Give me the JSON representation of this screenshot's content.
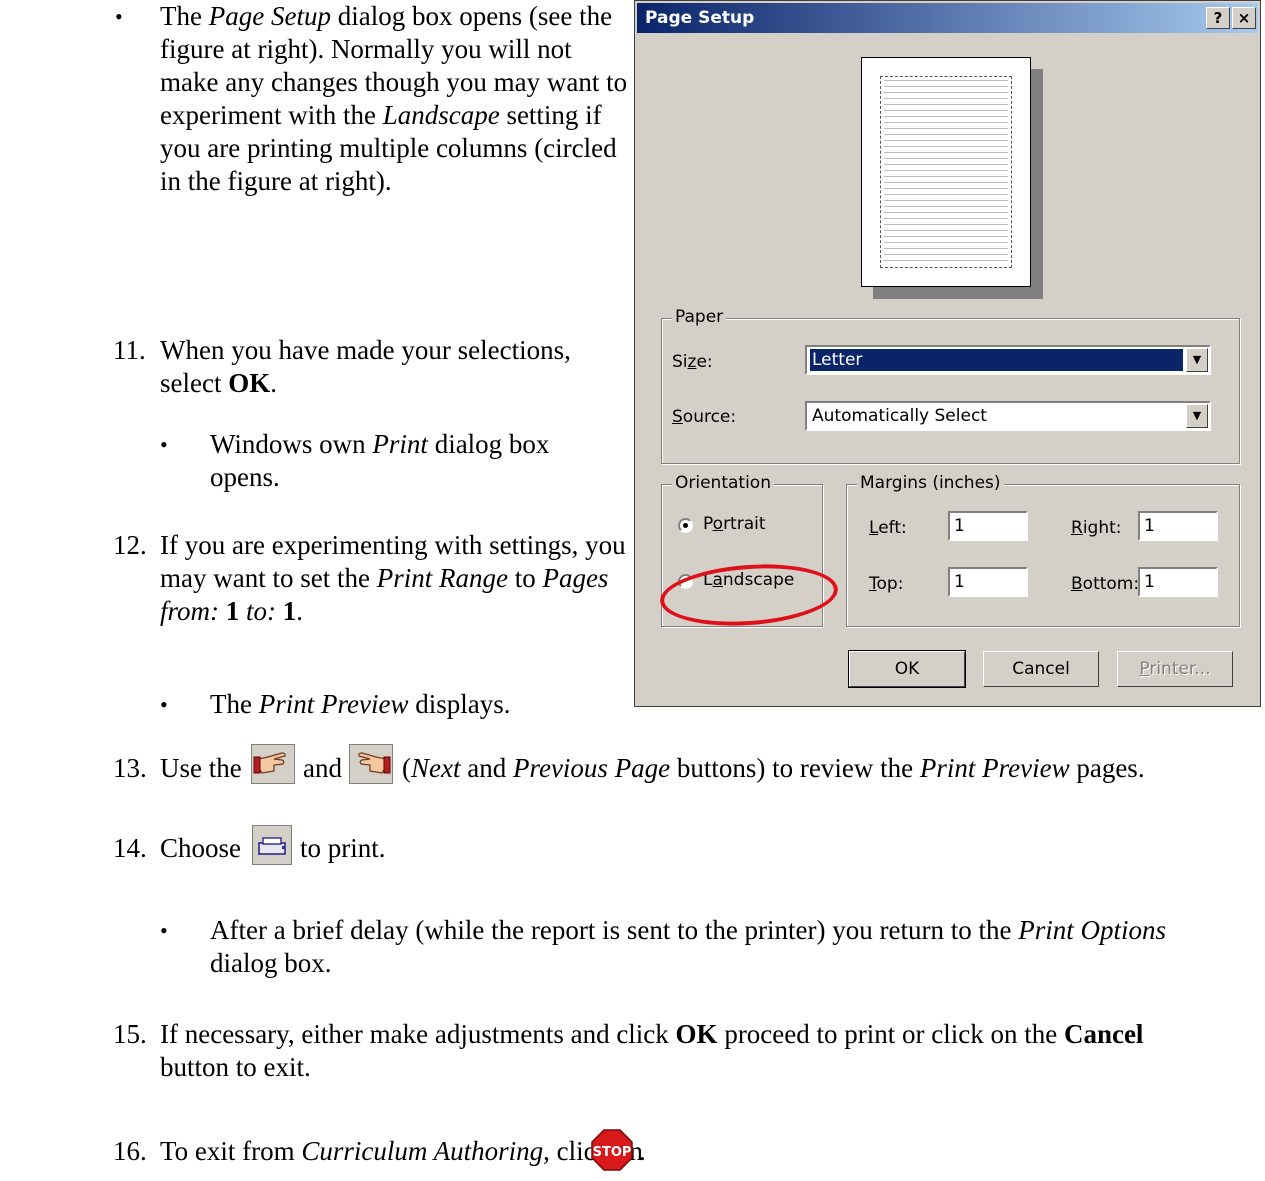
{
  "steps": {
    "b1_pre": "The ",
    "b1_em": "Page Setup",
    "b1_post": " dialog box opens (see the figure at right). Normally you will not make any changes though you may want to experiment with the",
    "b1_em2": "Landscape",
    "b1_post2": " setting if you are printing multiple columns (circled in the figure at right).",
    "s11_num": "11.",
    "s11_text": "When you have made your selections, select ",
    "s11_bold": "OK",
    "s11_end": ".",
    "b2_pre": "Windows own ",
    "b2_em": "Print",
    "b2_post": " dialog box opens.",
    "s12_num": "12.",
    "s12_text": "If you are experimenting with settings, you may want to set the ",
    "s12_em1": "Print Range",
    "s12_mid": " to",
    "s12_em2": "Pages from:",
    "s12_b1": "1",
    "s12_em3": "to:",
    "s12_b2": "1",
    "s12_end": ".",
    "b3_pre": "The ",
    "b3_em": "Print Preview",
    "b3_post": " displays.",
    "s13_num": "13.",
    "s13_pre": "Use the",
    "s13_and": "and",
    "s13_paren_open": "(",
    "s13_em1": "Next",
    "s13_and2": " and ",
    "s13_em2": "Previous Page",
    "s13_mid": " buttons) to review the ",
    "s13_em3": "Print Preview",
    "s13_end": " pages.",
    "s14_num": "14.",
    "s14_pre": "Choose",
    "s14_post": "to print.",
    "b4_text": "After a brief delay (while the report is sent to the printer) you return to the ",
    "b4_em": "Print Options",
    "b4_post": " dialog box.",
    "s15_num": "15.",
    "s15_pre": "If necessary, either make adjustments and click ",
    "s15_b1": "OK",
    "s15_mid": " proceed to print or click on the ",
    "s15_b2": "Cancel",
    "s15_post": "button to exit.",
    "s16_num": "16.",
    "s16_pre": "To exit from ",
    "s16_em": "Curriculum Authoring",
    "s16_post": ", click on",
    "s16_end": ".",
    "bullet": "•"
  },
  "dialog": {
    "title": "Page Setup",
    "help_btn": "?",
    "close_btn": "×",
    "paper_legend": "Paper",
    "size_label_pre": "Si",
    "size_label_u": "z",
    "size_label_post": "e:",
    "size_value": "Letter",
    "source_label_u": "S",
    "source_label_post": "ource:",
    "source_value": "Automatically Select",
    "orientation_legend": "Orientation",
    "portrait_pre": "P",
    "portrait_u": "o",
    "portrait_post": "rtrait",
    "landscape_pre": "L",
    "landscape_u": "a",
    "landscape_post": "ndscape",
    "margins_legend": "Margins (inches)",
    "left_u": "L",
    "left_post": "eft:",
    "left_value": "1",
    "right_u": "R",
    "right_post": "ight:",
    "right_value": "1",
    "top_u": "T",
    "top_post": "op:",
    "top_value": "1",
    "bottom_u": "B",
    "bottom_post": "ottom:",
    "bottom_value": "1",
    "ok": "OK",
    "cancel": "Cancel",
    "printer_u": "P",
    "printer_post": "rinter...",
    "orientation_selected": "Portrait"
  },
  "icons": {
    "next": "next-page-hand-icon",
    "previous": "previous-page-hand-icon",
    "print": "print-icon",
    "stop": "stop-sign-icon",
    "stop_text": "STOP",
    "stop_color": "#d7191c",
    "circle_color": "#e0101a"
  }
}
